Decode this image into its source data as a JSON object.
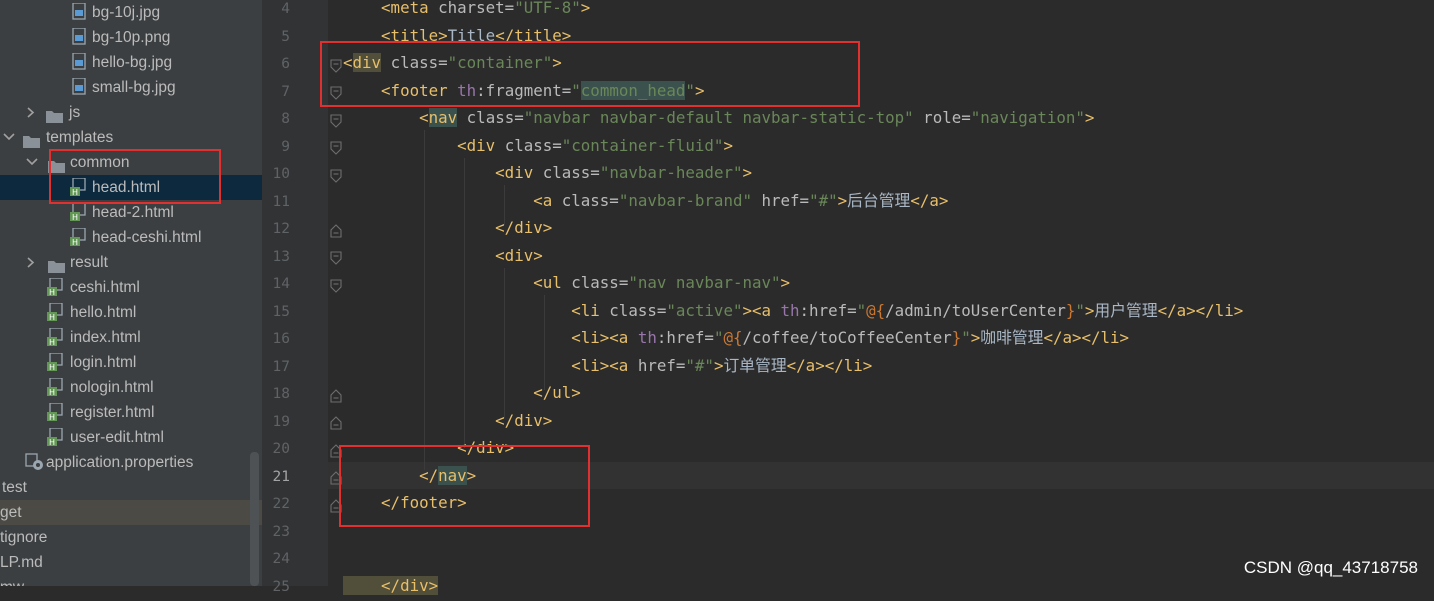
{
  "project_tree": {
    "items": [
      {
        "label": "bg-10j.jpg"
      },
      {
        "label": "bg-10p.png"
      },
      {
        "label": "hello-bg.jpg"
      },
      {
        "label": "small-bg.jpg"
      },
      {
        "label": "js"
      },
      {
        "label": "templates"
      },
      {
        "label": "common"
      },
      {
        "label": "head.html"
      },
      {
        "label": "head-2.html"
      },
      {
        "label": "head-ceshi.html"
      },
      {
        "label": "result"
      },
      {
        "label": "ceshi.html"
      },
      {
        "label": "hello.html"
      },
      {
        "label": "index.html"
      },
      {
        "label": "login.html"
      },
      {
        "label": "nologin.html"
      },
      {
        "label": "register.html"
      },
      {
        "label": "user-edit.html"
      },
      {
        "label": "application.properties"
      },
      {
        "label": "test"
      },
      {
        "label": "get"
      },
      {
        "label": "tignore"
      },
      {
        "label": "LP.md"
      },
      {
        "label": "mw"
      }
    ]
  },
  "editor": {
    "line_numbers": [
      "4",
      "5",
      "6",
      "7",
      "8",
      "9",
      "10",
      "11",
      "12",
      "13",
      "14",
      "15",
      "16",
      "17",
      "18",
      "19",
      "20",
      "21",
      "22",
      "23",
      "24",
      "25"
    ],
    "current_line": "21",
    "code": {
      "l4": {
        "p1": "    <meta ",
        "p2": "charset=",
        "p3": "\"UTF-8\"",
        "p4": ">"
      },
      "l5": {
        "p1": "    <title>",
        "p2": "Title",
        "p3": "</title>"
      },
      "l6": {
        "p0": "<",
        "p1": "div",
        "p2": " class=",
        "p3": "\"container\"",
        "p4": ">"
      },
      "l7": {
        "p1": "    <footer ",
        "p2": "th",
        "p3": ":fragment=",
        "p4": "\"",
        "p5": "common_head",
        "p6": "\"",
        "p7": ">"
      },
      "l8": {
        "p0": "        <",
        "p1": "nav",
        "p2": " class=",
        "p3": "\"navbar navbar-default navbar-static-top\"",
        "p4": " role=",
        "p5": "\"navigation\"",
        "p6": ">"
      },
      "l9": {
        "p1": "            <div ",
        "p2": "class=",
        "p3": "\"container-fluid\"",
        "p4": ">"
      },
      "l10": {
        "p1": "                <div ",
        "p2": "class=",
        "p3": "\"navbar-header\"",
        "p4": ">"
      },
      "l11": {
        "p1": "                    <a ",
        "p2": "class=",
        "p3": "\"navbar-brand\"",
        "p4": " href=",
        "p5": "\"#\"",
        "p6": ">",
        "p7": "后台管理",
        "p8": "</a>"
      },
      "l12": {
        "p1": "                </div>"
      },
      "l13": {
        "p1": "                <div>"
      },
      "l14": {
        "p1": "                    <ul ",
        "p2": "class=",
        "p3": "\"nav navbar-nav\"",
        "p4": ">"
      },
      "l15": {
        "p1": "                        <li ",
        "p2": "class=",
        "p3": "\"active\"",
        "p4": "><a ",
        "p5": "th",
        "p6": ":href=",
        "p7": "\"",
        "p8": "@{",
        "p9": "/admin/toUserCenter",
        "p10": "}",
        "p11": "\"",
        "p12": ">",
        "p13": "用户管理",
        "p14": "</a></li>"
      },
      "l16": {
        "p1": "                        <li><a ",
        "p2": "th",
        "p3": ":href=",
        "p4": "\"",
        "p5": "@{",
        "p6": "/coffee/toCoffeeCenter",
        "p7": "}",
        "p8": "\"",
        "p9": ">",
        "p10": "咖啡管理",
        "p11": "</a></li>"
      },
      "l17": {
        "p1": "                        <li><a ",
        "p2": "href=",
        "p3": "\"#\"",
        "p4": ">",
        "p5": "订单管理",
        "p6": "</a></li>"
      },
      "l18": {
        "p1": "                    </ul>"
      },
      "l19": {
        "p1": "                </div>"
      },
      "l20": {
        "p1": "            </div>"
      },
      "l21": {
        "p0": "        </",
        "p1": "nav",
        "p2": ">"
      },
      "l22": {
        "p1": "    </footer>"
      },
      "l25": {
        "p1": "    </div>"
      }
    }
  },
  "watermark": "CSDN @qq_43718758",
  "colors": {
    "highlight_box": "#e03030",
    "tag": "#e8bf6a",
    "string": "#6a8759",
    "namespace": "#9876aa",
    "sidebar_bg": "#3c3f41",
    "editor_bg": "#2b2b2b"
  }
}
